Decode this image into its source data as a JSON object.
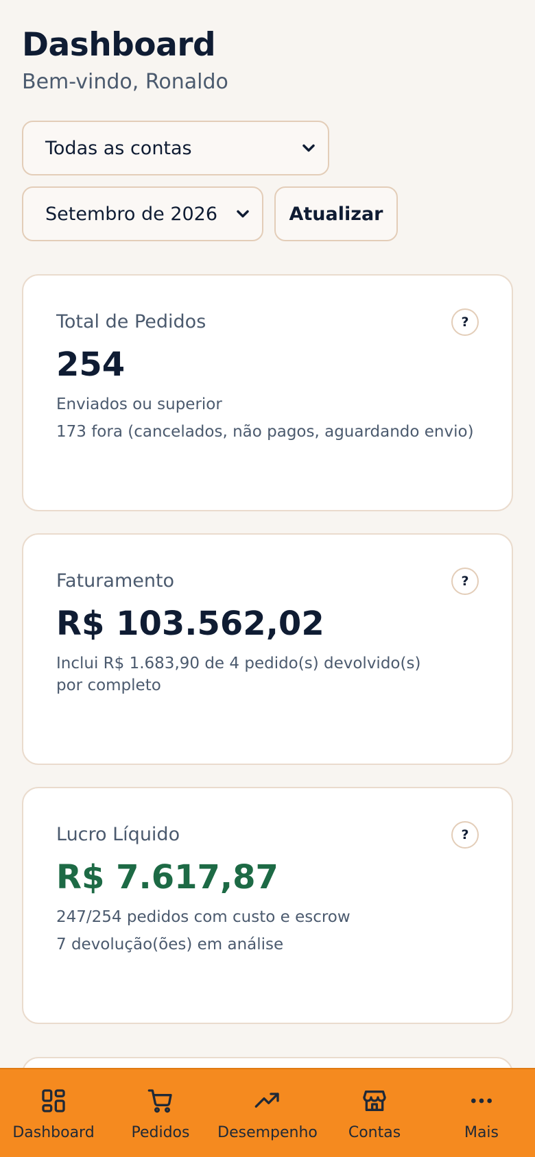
{
  "header": {
    "title": "Dashboard",
    "subtitle": "Bem-vindo, Ronaldo"
  },
  "filters": {
    "account_select": {
      "value": "Todas as contas"
    },
    "month_select": {
      "value": "Setembro de 2026"
    },
    "refresh_label": "Atualizar"
  },
  "cards": [
    {
      "label": "Total de Pedidos",
      "value": "254",
      "notes": [
        "Enviados ou superior",
        "173 fora (cancelados, não pagos, aguardando envio)"
      ],
      "help": "?"
    },
    {
      "label": "Faturamento",
      "value": "R$ 103.562,02",
      "notes": [
        "Inclui R$ 1.683,90 de 4 pedido(s) devolvido(s) por completo"
      ],
      "help": "?"
    },
    {
      "label": "Lucro Líquido",
      "value": "R$ 7.617,87",
      "value_color": "#1d6a45",
      "notes": [
        "247/254 pedidos com custo e escrow",
        "7 devolução(ões) em análise"
      ],
      "help": "?"
    }
  ],
  "nav": {
    "items": [
      {
        "label": "Dashboard",
        "icon": "dashboard-icon"
      },
      {
        "label": "Pedidos",
        "icon": "cart-icon"
      },
      {
        "label": "Desempenho",
        "icon": "trending-up-icon"
      },
      {
        "label": "Contas",
        "icon": "store-icon"
      },
      {
        "label": "Mais",
        "icon": "more-icon"
      }
    ]
  },
  "colors": {
    "background": "#f8f5f1",
    "nav_bar": "#f58a1f",
    "profit_green": "#1d6a45",
    "border": "#eadbcd"
  }
}
